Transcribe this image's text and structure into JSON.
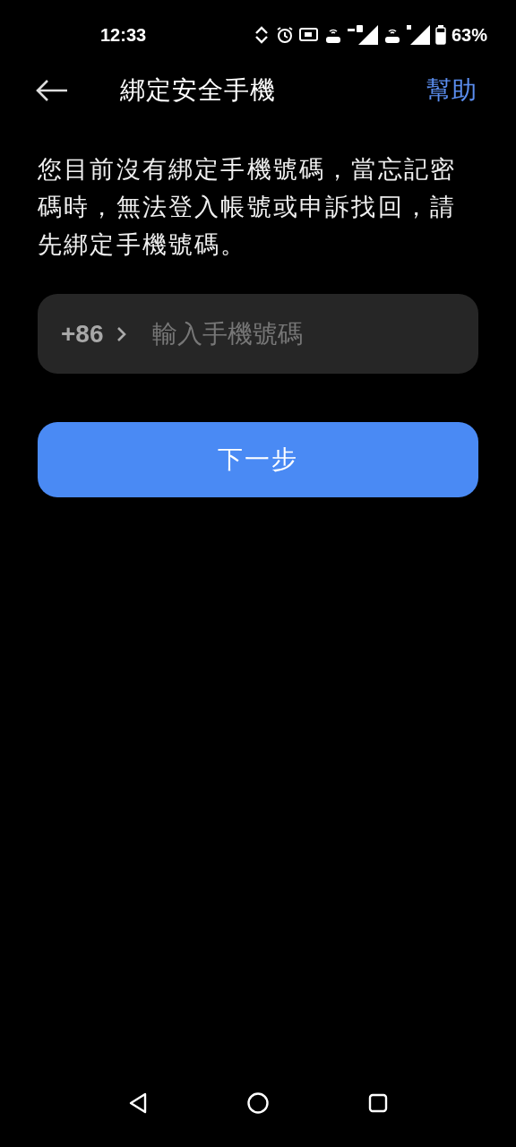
{
  "status_bar": {
    "time": "12:33",
    "battery": "63%"
  },
  "header": {
    "title": "綁定安全手機",
    "help": "幫助"
  },
  "message": "您目前沒有綁定手機號碼，當忘記密碼時，無法登入帳號或申訴找回，請先綁定手機號碼。",
  "phone_field": {
    "country_code": "+86",
    "placeholder": "輸入手機號碼"
  },
  "next_button": "下一步"
}
